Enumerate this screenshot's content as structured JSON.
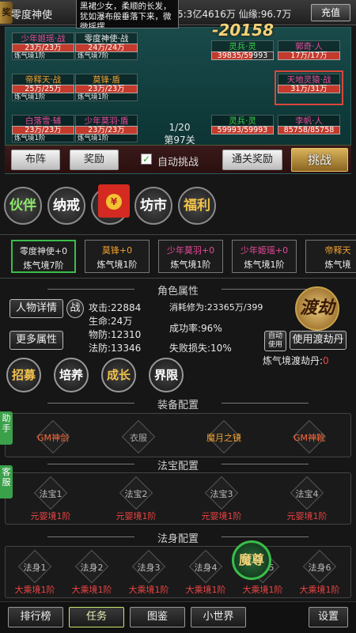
{
  "topbar": {
    "avatar_glyph": "奖",
    "player_name": "零度神使",
    "resources": "5:3亿4616万  仙缘:96.7万",
    "topup_label": "充值",
    "notice": "黑裙少女，柔顺的长发，犹如瀑布般垂落下来，微微摇摆...",
    "power": "-20158"
  },
  "field": {
    "allies": [
      {
        "name": "少年姬瑶·战",
        "hp": "23万/23万",
        "realm": "炼气境1阶",
        "fill": 1.0,
        "name_color": "#e84a9a"
      },
      {
        "name": "零度神使·战",
        "hp": "24万/24万",
        "realm": "炼气境7阶",
        "fill": 1.0,
        "name_color": "#e8e8e8"
      },
      {
        "name": "帝释天·战",
        "hp": "25万/25万",
        "realm": "炼气境1阶",
        "fill": 1.0,
        "name_color": "#f0a030"
      },
      {
        "name": "莫锋·盾",
        "hp": "23万/23万",
        "realm": "炼气境1阶",
        "fill": 1.0,
        "name_color": "#f0a030"
      },
      {
        "name": "白落雪·辅",
        "hp": "23万/23万",
        "realm": "炼气境1阶",
        "fill": 1.0,
        "name_color": "#e84a9a"
      },
      {
        "name": "少年莫羽·盾",
        "hp": "23万/23万",
        "realm": "炼气境1阶",
        "fill": 1.0,
        "name_color": "#e84a9a"
      }
    ],
    "enemies": [
      {
        "name": "灵兵·灵",
        "hp": "39835/59993",
        "realm": "",
        "fill": 0.66,
        "name_color": "#3bd04a"
      },
      {
        "name": "郭奇·人",
        "hp": "17万/17万",
        "realm": "",
        "fill": 1.0,
        "name_color": "#e84a9a"
      },
      {
        "name": "天地灵猿·战",
        "hp": "31万/31万",
        "realm": "",
        "fill": 1.0,
        "name_color": "#e84a9a"
      },
      {
        "name": "灵兵·灵",
        "hp": "59993/59993",
        "realm": "",
        "fill": 1.0,
        "name_color": "#3bd04a"
      },
      {
        "name": "李帆·人",
        "hp": "85758/85758",
        "realm": "",
        "fill": 1.0,
        "name_color": "#e84a9a"
      }
    ],
    "page": "1/20",
    "stage": "第97关"
  },
  "actions": {
    "formation": "布阵",
    "reward": "奖励",
    "auto_check": "✓",
    "auto_label": "自动挑战",
    "clear_reward": "通关奖励",
    "challenge": "挑战"
  },
  "menu": {
    "partner": "伙伴",
    "ring": "纳戒",
    "hidden": "洞",
    "redpack_coin": "¥",
    "market": "坊市",
    "welfare": "福利"
  },
  "cards": [
    {
      "name": "零度神使+0",
      "realm": "炼气境7阶",
      "color": "#e8e8e8"
    },
    {
      "name": "莫锋+0",
      "realm": "炼气境1阶",
      "color": "#f0a030"
    },
    {
      "name": "少年莫羽+0",
      "realm": "炼气境1阶",
      "color": "#e84a9a"
    },
    {
      "name": "少年姬瑶+0",
      "realm": "炼气境1阶",
      "color": "#e84a9a"
    },
    {
      "name": "帝释天",
      "realm": "炼气境",
      "color": "#f0a030"
    }
  ],
  "attributes": {
    "title": "角色属性",
    "detail_btn": "人物详情",
    "battle_btn": "战",
    "more_btn": "更多属性",
    "attack": "攻击:22884",
    "hp": "生命:24万",
    "def": "物防:12310",
    "mdef": "法防:13346",
    "cost": "消耗修为:23365万/399",
    "rate": "成功率:96%",
    "loss": "失败损失:10%",
    "dujie": "渡劫",
    "auto_use": "自动使用",
    "use_pill": "使用渡劫丹",
    "pill_label": "炼气境渡劫丹:",
    "pill_count": "0"
  },
  "growth": {
    "recruit": "招募",
    "train": "培养",
    "grow": "成长",
    "limit": "界限"
  },
  "equip": {
    "title": "装备配置",
    "side": "助手",
    "items": [
      {
        "name": "GM神剑",
        "color": "#ff6a3a"
      },
      {
        "name": "衣服",
        "color": "#aaaaaa"
      },
      {
        "name": "魔月之镜",
        "color": "#f0a030"
      },
      {
        "name": "GM神靴",
        "color": "#ff6a3a"
      }
    ]
  },
  "treasure": {
    "title": "法宝配置",
    "side": "客服",
    "items": [
      {
        "name": "法宝1",
        "level": "元婴境1阶"
      },
      {
        "name": "法宝2",
        "level": "元婴境1阶"
      },
      {
        "name": "法宝3",
        "level": "元婴境1阶"
      },
      {
        "name": "法宝4",
        "level": "元婴境1阶"
      }
    ]
  },
  "body": {
    "title": "法身配置",
    "mozun": "魔尊",
    "items": [
      {
        "name": "法身1",
        "level": "大乘境1阶"
      },
      {
        "name": "法身2",
        "level": "大乘境1阶"
      },
      {
        "name": "法身3",
        "level": "大乘境1阶"
      },
      {
        "name": "法身4",
        "level": "大乘境1阶"
      },
      {
        "name": "法身5",
        "level": "大乘境1阶"
      },
      {
        "name": "法身6",
        "level": "大乘境1阶"
      }
    ]
  },
  "bottom": {
    "rank": "排行榜",
    "task": "任务",
    "atlas": "图鉴",
    "world": "小世界",
    "settings": "设置"
  }
}
